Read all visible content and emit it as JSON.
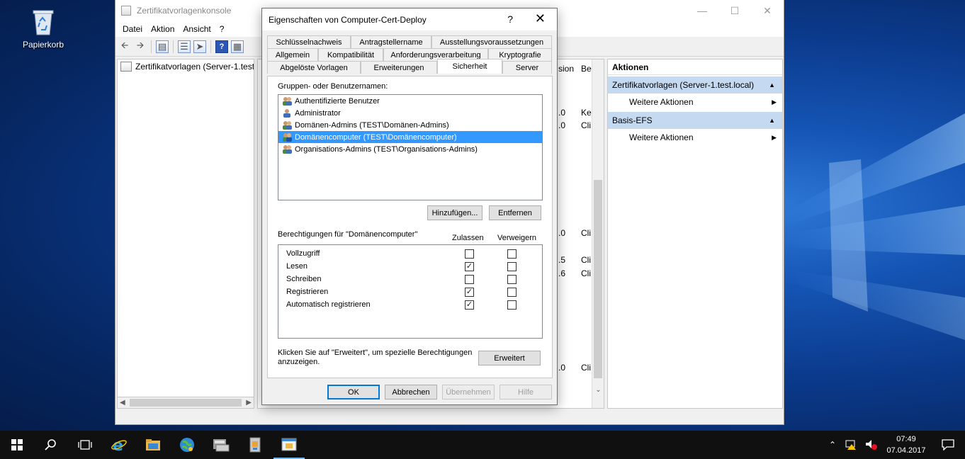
{
  "desktop": {
    "recycle_bin_label": "Papierkorb"
  },
  "mmc": {
    "title": "Zertifikatvorlagenkonsole",
    "menu": [
      "Datei",
      "Aktion",
      "Ansicht",
      "?"
    ],
    "tree_item": "Zertifikatvorlagen (Server-1.test.",
    "center": {
      "col_version": "sion",
      "col_be": "Be",
      "rows": [
        {
          "ver": ".0",
          "be": "Ke"
        },
        {
          "ver": ".0",
          "be": "Cli"
        },
        {
          "ver": ".0",
          "be": "Cli"
        },
        {
          "ver": ".5",
          "be": "Cli"
        },
        {
          "ver": ".6",
          "be": "Cli"
        },
        {
          "ver": ".0",
          "be": "Cli"
        }
      ]
    },
    "actions": {
      "title": "Aktionen",
      "group1": "Zertifikatvorlagen (Server-1.test.local)",
      "group1_item": "Weitere Aktionen",
      "group2": "Basis-EFS",
      "group2_item": "Weitere Aktionen"
    }
  },
  "dialog": {
    "title": "Eigenschaften von Computer-Cert-Deploy",
    "help": "?",
    "close": "✕",
    "tabs_row1": [
      "Schlüsselnachweis",
      "Antragstellername",
      "Ausstellungsvoraussetzungen"
    ],
    "tabs_row2": [
      "Allgemein",
      "Kompatibilität",
      "Anforderungsverarbeitung",
      "Kryptografie"
    ],
    "tabs_row3": [
      "Abgelöste Vorlagen",
      "Erweiterungen",
      "Sicherheit",
      "Server"
    ],
    "groups_label": "Gruppen- oder Benutzernamen:",
    "users": [
      "Authentifizierte Benutzer",
      "Administrator",
      "Domänen-Admins (TEST\\Domänen-Admins)",
      "Domänencomputer (TEST\\Domänencomputer)",
      "Organisations-Admins (TEST\\Organisations-Admins)"
    ],
    "add_button": "Hinzufügen...",
    "remove_button": "Entfernen",
    "perms_label": "Berechtigungen für \"Domänencomputer\"",
    "allow_header": "Zulassen",
    "deny_header": "Verweigern",
    "permissions": [
      {
        "name": "Vollzugriff",
        "allow": false,
        "deny": false
      },
      {
        "name": "Lesen",
        "allow": true,
        "deny": false
      },
      {
        "name": "Schreiben",
        "allow": false,
        "deny": false
      },
      {
        "name": "Registrieren",
        "allow": true,
        "deny": false
      },
      {
        "name": "Automatisch registrieren",
        "allow": true,
        "deny": false
      }
    ],
    "advanced_hint_1": "Klicken Sie auf \"Erweitert\", um spezielle Berechtigungen",
    "advanced_hint_2": "anzuzeigen.",
    "advanced_button": "Erweitert",
    "ok": "OK",
    "cancel": "Abbrechen",
    "apply": "Übernehmen",
    "help_button": "Hilfe"
  },
  "taskbar": {
    "time": "07:49",
    "date": "07.04.2017"
  }
}
